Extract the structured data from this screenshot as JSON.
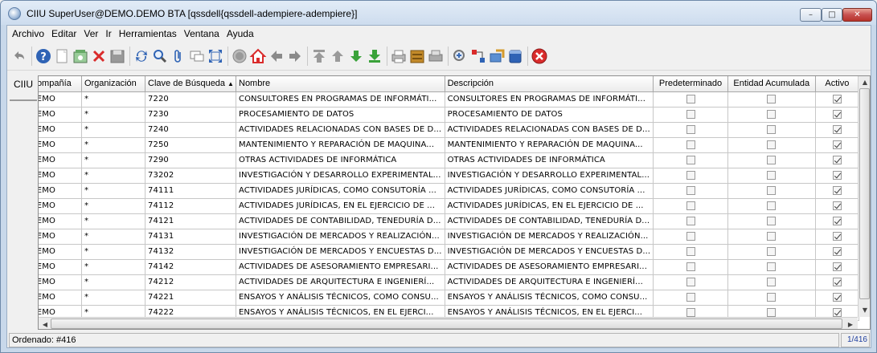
{
  "window": {
    "title": "CIIU  SuperUser@DEMO.DEMO BTA [qssdell{qssdell-adempiere-adempiere}]",
    "minimize_label": "–",
    "maximize_label": "□",
    "close_label": "✕"
  },
  "menu": [
    "Archivo",
    "Editar",
    "Ver",
    "Ir",
    "Herramientas",
    "Ventana",
    "Ayuda"
  ],
  "toolbar": {
    "icons": [
      "undo-icon",
      "sep",
      "help-icon",
      "new-record-icon",
      "copy-record-icon",
      "delete-icon",
      "save-icon",
      "sep",
      "refresh-icon",
      "find-icon",
      "attachment-icon",
      "chat-icon",
      "multi-row-icon",
      "sep",
      "history-icon",
      "home-icon",
      "parent-record-icon",
      "detail-record-icon",
      "sep",
      "first-record-icon",
      "previous-record-icon",
      "next-record-icon",
      "last-record-icon",
      "sep",
      "report-icon",
      "archive-icon",
      "print-icon",
      "sep",
      "zoom-across-icon",
      "workflow-icon",
      "request-icon",
      "product-info-icon",
      "sep",
      "close-window-icon"
    ],
    "colors": {
      "accent_blue": "#2f63b5",
      "accent_green": "#3aa23a",
      "accent_red": "#d92b2b",
      "neutral_gray": "#8a8a8a"
    }
  },
  "side_tab": {
    "label": "CIIU"
  },
  "grid": {
    "columns": [
      {
        "label": "Compañía"
      },
      {
        "label": "Organización"
      },
      {
        "label": "Clave de Búsqueda",
        "sort": "ascending"
      },
      {
        "label": "Nombre"
      },
      {
        "label": "Descripción"
      },
      {
        "label": "Predeterminado"
      },
      {
        "label": "Entidad Acumulada"
      },
      {
        "label": "Activo"
      }
    ],
    "rows": [
      {
        "company": "DEMO",
        "org": "*",
        "key": "7220",
        "name": "CONSULTORES EN PROGRAMAS DE INFORMÁTI...",
        "desc": "CONSULTORES EN PROGRAMAS DE INFORMÁTI...",
        "default": false,
        "summary": false,
        "active": true
      },
      {
        "company": "DEMO",
        "org": "*",
        "key": "7230",
        "name": "PROCESAMIENTO DE DATOS",
        "desc": "PROCESAMIENTO DE DATOS",
        "default": false,
        "summary": false,
        "active": true
      },
      {
        "company": "DEMO",
        "org": "*",
        "key": "7240",
        "name": "ACTIVIDADES RELACIONADAS CON BASES DE D...",
        "desc": "ACTIVIDADES RELACIONADAS CON BASES DE D...",
        "default": false,
        "summary": false,
        "active": true
      },
      {
        "company": "DEMO",
        "org": "*",
        "key": "7250",
        "name": "MANTENIMIENTO Y REPARACIÓN DE MAQUINA...",
        "desc": "MANTENIMIENTO Y REPARACIÓN DE MAQUINA...",
        "default": false,
        "summary": false,
        "active": true
      },
      {
        "company": "DEMO",
        "org": "*",
        "key": "7290",
        "name": "OTRAS ACTIVIDADES DE INFORMÁTICA",
        "desc": "OTRAS ACTIVIDADES DE INFORMÁTICA",
        "default": false,
        "summary": false,
        "active": true
      },
      {
        "company": "DEMO",
        "org": "*",
        "key": "73202",
        "name": "INVESTIGACIÓN Y DESARROLLO EXPERIMENTAL...",
        "desc": "INVESTIGACIÓN Y DESARROLLO EXPERIMENTAL...",
        "default": false,
        "summary": false,
        "active": true
      },
      {
        "company": "DEMO",
        "org": "*",
        "key": "74111",
        "name": "ACTIVIDADES JURÍDICAS, COMO CONSUTORÍA ...",
        "desc": "ACTIVIDADES JURÍDICAS, COMO CONSUTORÍA ...",
        "default": false,
        "summary": false,
        "active": true
      },
      {
        "company": "DEMO",
        "org": "*",
        "key": "74112",
        "name": "ACTIVIDADES JURÍDICAS, EN EL EJERCICIO DE ...",
        "desc": "ACTIVIDADES JURÍDICAS, EN EL EJERCICIO DE ...",
        "default": false,
        "summary": false,
        "active": true
      },
      {
        "company": "DEMO",
        "org": "*",
        "key": "74121",
        "name": "ACTIVIDADES DE CONTABILIDAD, TENEDURÍA D...",
        "desc": "ACTIVIDADES DE CONTABILIDAD, TENEDURÍA D...",
        "default": false,
        "summary": false,
        "active": true
      },
      {
        "company": "DEMO",
        "org": "*",
        "key": "74131",
        "name": "INVESTIGACIÓN DE MERCADOS Y REALIZACIÓN...",
        "desc": "INVESTIGACIÓN DE MERCADOS Y REALIZACIÓN...",
        "default": false,
        "summary": false,
        "active": true
      },
      {
        "company": "DEMO",
        "org": "*",
        "key": "74132",
        "name": "INVESTIGACIÓN DE MERCADOS Y ENCUESTAS D...",
        "desc": "INVESTIGACIÓN DE MERCADOS Y ENCUESTAS D...",
        "default": false,
        "summary": false,
        "active": true
      },
      {
        "company": "DEMO",
        "org": "*",
        "key": "74142",
        "name": "ACTIVIDADES DE ASESORAMIENTO EMPRESARI...",
        "desc": "ACTIVIDADES DE ASESORAMIENTO EMPRESARI...",
        "default": false,
        "summary": false,
        "active": true
      },
      {
        "company": "DEMO",
        "org": "*",
        "key": "74212",
        "name": "ACTIVIDADES DE ARQUITECTURA E INGENIERÍ...",
        "desc": "ACTIVIDADES DE ARQUITECTURA E INGENIERÍ...",
        "default": false,
        "summary": false,
        "active": true
      },
      {
        "company": "DEMO",
        "org": "*",
        "key": "74221",
        "name": "ENSAYOS Y ANÁLISIS TÉCNICOS, COMO CONSU...",
        "desc": "ENSAYOS Y ANÁLISIS TÉCNICOS, COMO CONSU...",
        "default": false,
        "summary": false,
        "active": true
      },
      {
        "company": "DEMO",
        "org": "*",
        "key": "74222",
        "name": "ENSAYOS Y ANÁLISIS TÉCNICOS, EN EL EJERCI...",
        "desc": "ENSAYOS Y ANÁLISIS TÉCNICOS, EN EL EJERCI...",
        "default": false,
        "summary": false,
        "active": true
      }
    ]
  },
  "status": {
    "message": "Ordenado: #416",
    "record_position": "1/416"
  }
}
